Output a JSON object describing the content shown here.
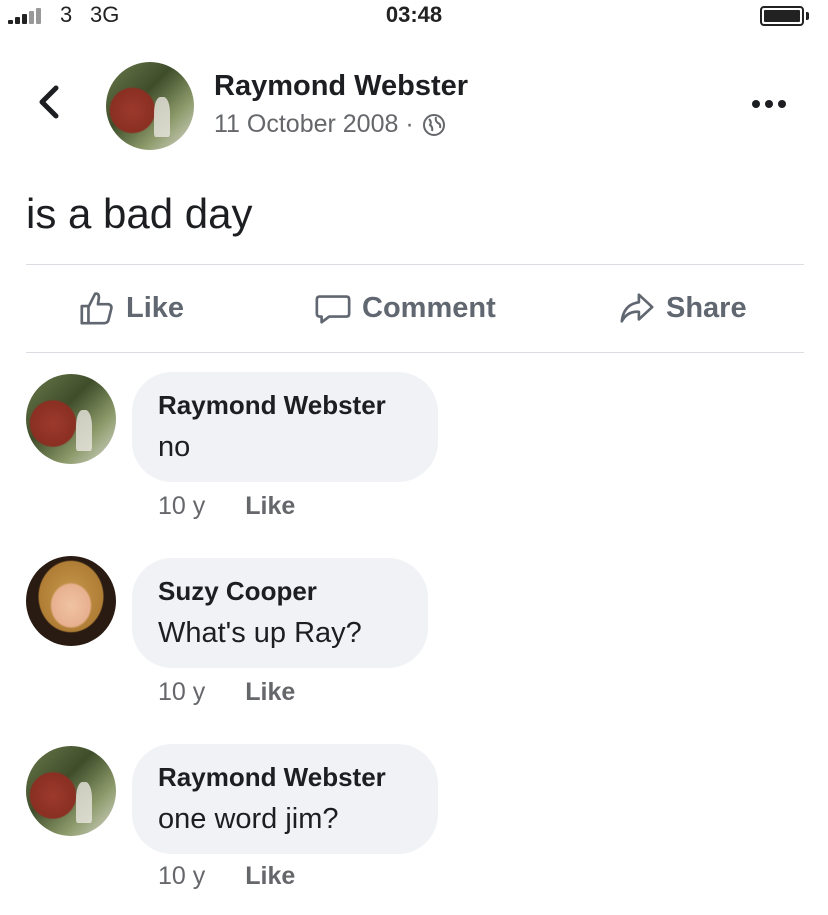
{
  "status_bar": {
    "carrier": "3",
    "network": "3G",
    "time": "03:48"
  },
  "post": {
    "author": "Raymond Webster",
    "date": "11 October 2008 ·",
    "privacy_icon": "globe-icon",
    "text": "is a bad day"
  },
  "actions": {
    "like": "Like",
    "comment": "Comment",
    "share": "Share"
  },
  "comments": [
    {
      "author": "Raymond Webster",
      "text": "no",
      "age": "10 y",
      "like": "Like"
    },
    {
      "author": "Suzy Cooper",
      "text": "What's up Ray?",
      "age": "10 y",
      "like": "Like"
    },
    {
      "author": "Raymond Webster",
      "text": "one word jim?",
      "age": "10 y",
      "like": "Like"
    }
  ],
  "colors": {
    "text": "#1c1e21",
    "secondary": "#65676b",
    "bubble": "#f0f2f5",
    "divider": "#dadde1"
  }
}
